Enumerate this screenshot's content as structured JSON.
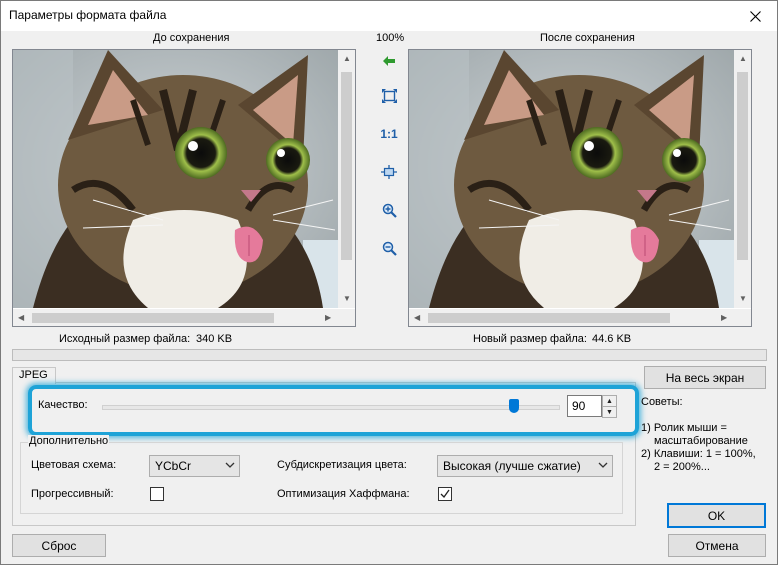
{
  "window": {
    "title": "Параметры формата файла"
  },
  "zoom_level": "100%",
  "before": {
    "header": "До сохранения",
    "size_label": "Исходный размер файла:",
    "size_value": "340 KB"
  },
  "after": {
    "header": "После сохранения",
    "size_label": "Новый размер файла:",
    "size_value": "44.6 KB"
  },
  "toolbar": {
    "actual_size_label": "1:1"
  },
  "tab": {
    "label": "JPEG"
  },
  "quality": {
    "label": "Качество:",
    "value": "90",
    "slider_level_percent": 90
  },
  "advanced": {
    "title": "Дополнительно",
    "color_scheme_label": "Цветовая схема:",
    "color_scheme_value": "YCbCr",
    "subsampling_label": "Субдискретизация цвета:",
    "subsampling_value": "Высокая (лучше сжатие)",
    "progressive_label": "Прогрессивный:",
    "progressive_checked": false,
    "huffman_label": "Оптимизация Хаффмана:",
    "huffman_checked": true
  },
  "buttons": {
    "fullscreen": "На весь экран",
    "ok": "OK",
    "cancel": "Отмена",
    "reset": "Сброс"
  },
  "tips": {
    "title": "Советы:",
    "line1": "1) Ролик мыши =",
    "line2": "масштабирование",
    "line3": "2) Клавиши: 1 = 100%,",
    "line4": "2 = 200%..."
  },
  "colors": {
    "accent": "#0078d7",
    "highlight": "#1ea3d7"
  }
}
